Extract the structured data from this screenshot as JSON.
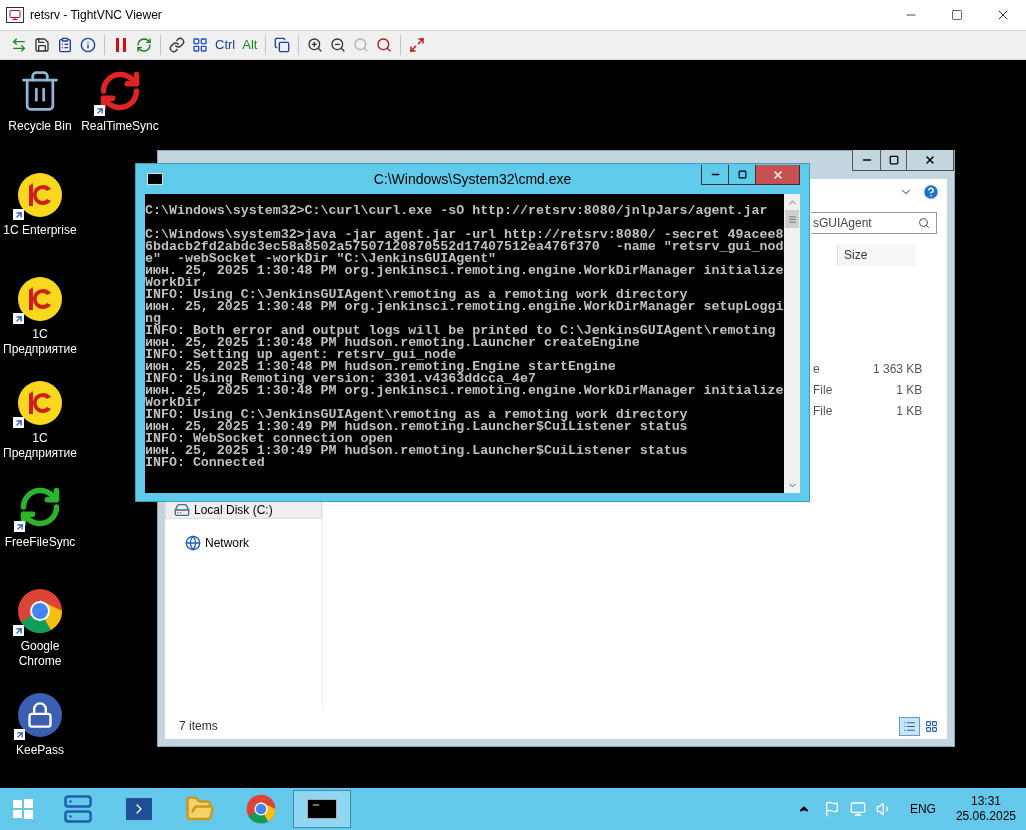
{
  "vnc_window": {
    "title": "retsrv - TightVNC Viewer"
  },
  "toolbar_groups": [
    [
      {
        "kind": "new-connection",
        "disabled": false
      },
      {
        "kind": "save",
        "disabled": false
      },
      {
        "kind": "options",
        "disabled": false
      },
      {
        "kind": "info",
        "disabled": false
      }
    ],
    [
      {
        "kind": "pause",
        "disabled": false
      },
      {
        "kind": "refresh",
        "disabled": false
      }
    ],
    [
      {
        "kind": "ctrl-alt-del",
        "disabled": false
      },
      {
        "kind": "ctrl-esc",
        "disabled": false
      },
      {
        "kind": "ctrl-text",
        "label": "Ctrl",
        "disabled": false
      },
      {
        "kind": "alt-text",
        "label": "Alt",
        "disabled": false
      }
    ],
    [
      {
        "kind": "clipboard",
        "disabled": false
      }
    ],
    [
      {
        "kind": "zoom-in",
        "disabled": false
      },
      {
        "kind": "zoom-out",
        "disabled": false
      },
      {
        "kind": "zoom-100",
        "disabled": true
      },
      {
        "kind": "zoom-auto",
        "disabled": false
      }
    ],
    [
      {
        "kind": "fullscreen",
        "disabled": false
      }
    ]
  ],
  "desktop": {
    "top_row": [
      {
        "label": "Recycle Bin",
        "kind": "recycle-bin",
        "shortcut": false
      },
      {
        "label": "RealTimeSync",
        "kind": "sync-red",
        "shortcut": true
      }
    ],
    "column": [
      {
        "label": "1C Enterprise",
        "kind": "onec",
        "shortcut": true
      },
      {
        "label": "1C Предприятие",
        "kind": "onec",
        "shortcut": true
      },
      {
        "label": "1C Предприятие",
        "kind": "onec",
        "shortcut": true
      },
      {
        "label": "FreeFileSync",
        "kind": "sync-green",
        "shortcut": true
      },
      {
        "label": "Google Chrome",
        "kind": "chrome",
        "shortcut": true
      },
      {
        "label": "KeePass",
        "kind": "lock",
        "shortcut": true
      }
    ]
  },
  "explorer": {
    "search": {
      "value": "sGUIAgent"
    },
    "columns": [
      "Size"
    ],
    "rows": [
      {
        "type": "e",
        "size": "1 363 KB"
      },
      {
        "type": "File",
        "size": "1 KB"
      },
      {
        "type": "File",
        "size": "1 KB"
      }
    ],
    "nav": [
      {
        "label": "Local Disk (C:)",
        "kind": "drive",
        "selected": true
      },
      {
        "label": "Network",
        "kind": "network",
        "selected": false
      }
    ],
    "status": "7 items",
    "views": [
      {
        "kind": "details",
        "selected": true
      },
      {
        "kind": "large-icons",
        "selected": false
      }
    ]
  },
  "cmd": {
    "title": "C:\\Windows\\System32\\cmd.exe",
    "blocks": [
      [
        "C:\\Windows\\system32>C:\\curl\\curl.exe -sO http://retsrv:8080/jnlpJars/agent.jar"
      ],
      [
        "C:\\Windows\\system32>java -jar agent.jar -url http://retsrv:8080/ -secret 49acee8",
        "6bdacb2fd2abdc3ec58a8502a57507120870552d17407512ea476f370  -name \"retsrv_gui_nod",
        "e\"  -webSocket -workDir \"C:\\JenkinsGUIAgent\"",
        "июн. 25, 2025 1:30:48 PM org.jenkinsci.remoting.engine.WorkDirManager initialize",
        "WorkDir",
        "INFO: Using C:\\JenkinsGUIAgent\\remoting as a remoting work directory",
        "июн. 25, 2025 1:30:48 PM org.jenkinsci.remoting.engine.WorkDirManager setupLoggi",
        "ng",
        "INFO: Both error and output logs will be printed to C:\\JenkinsGUIAgent\\remoting",
        "июн. 25, 2025 1:30:48 PM hudson.remoting.Launcher createEngine",
        "INFO: Setting up agent: retsrv_gui_node",
        "июн. 25, 2025 1:30:48 PM hudson.remoting.Engine startEngine",
        "INFO: Using Remoting version: 3301.v4363ddcca_4e7",
        "июн. 25, 2025 1:30:48 PM org.jenkinsci.remoting.engine.WorkDirManager initialize",
        "WorkDir",
        "INFO: Using C:\\JenkinsGUIAgent\\remoting as a remoting work directory",
        "июн. 25, 2025 1:30:49 PM hudson.remoting.Launcher$CuiListener status",
        "INFO: WebSocket connection open",
        "июн. 25, 2025 1:30:49 PM hudson.remoting.Launcher$CuiListener status",
        "INFO: Connected"
      ]
    ]
  },
  "taskbar": {
    "items": [
      {
        "kind": "server-manager",
        "selected": false
      },
      {
        "kind": "powershell",
        "selected": false
      },
      {
        "kind": "explorer",
        "selected": false
      },
      {
        "kind": "chrome",
        "selected": false
      },
      {
        "kind": "cmd",
        "selected": true
      }
    ],
    "tray": {
      "language": "ENG",
      "time": "13:31",
      "date": "25.06.2025"
    }
  }
}
